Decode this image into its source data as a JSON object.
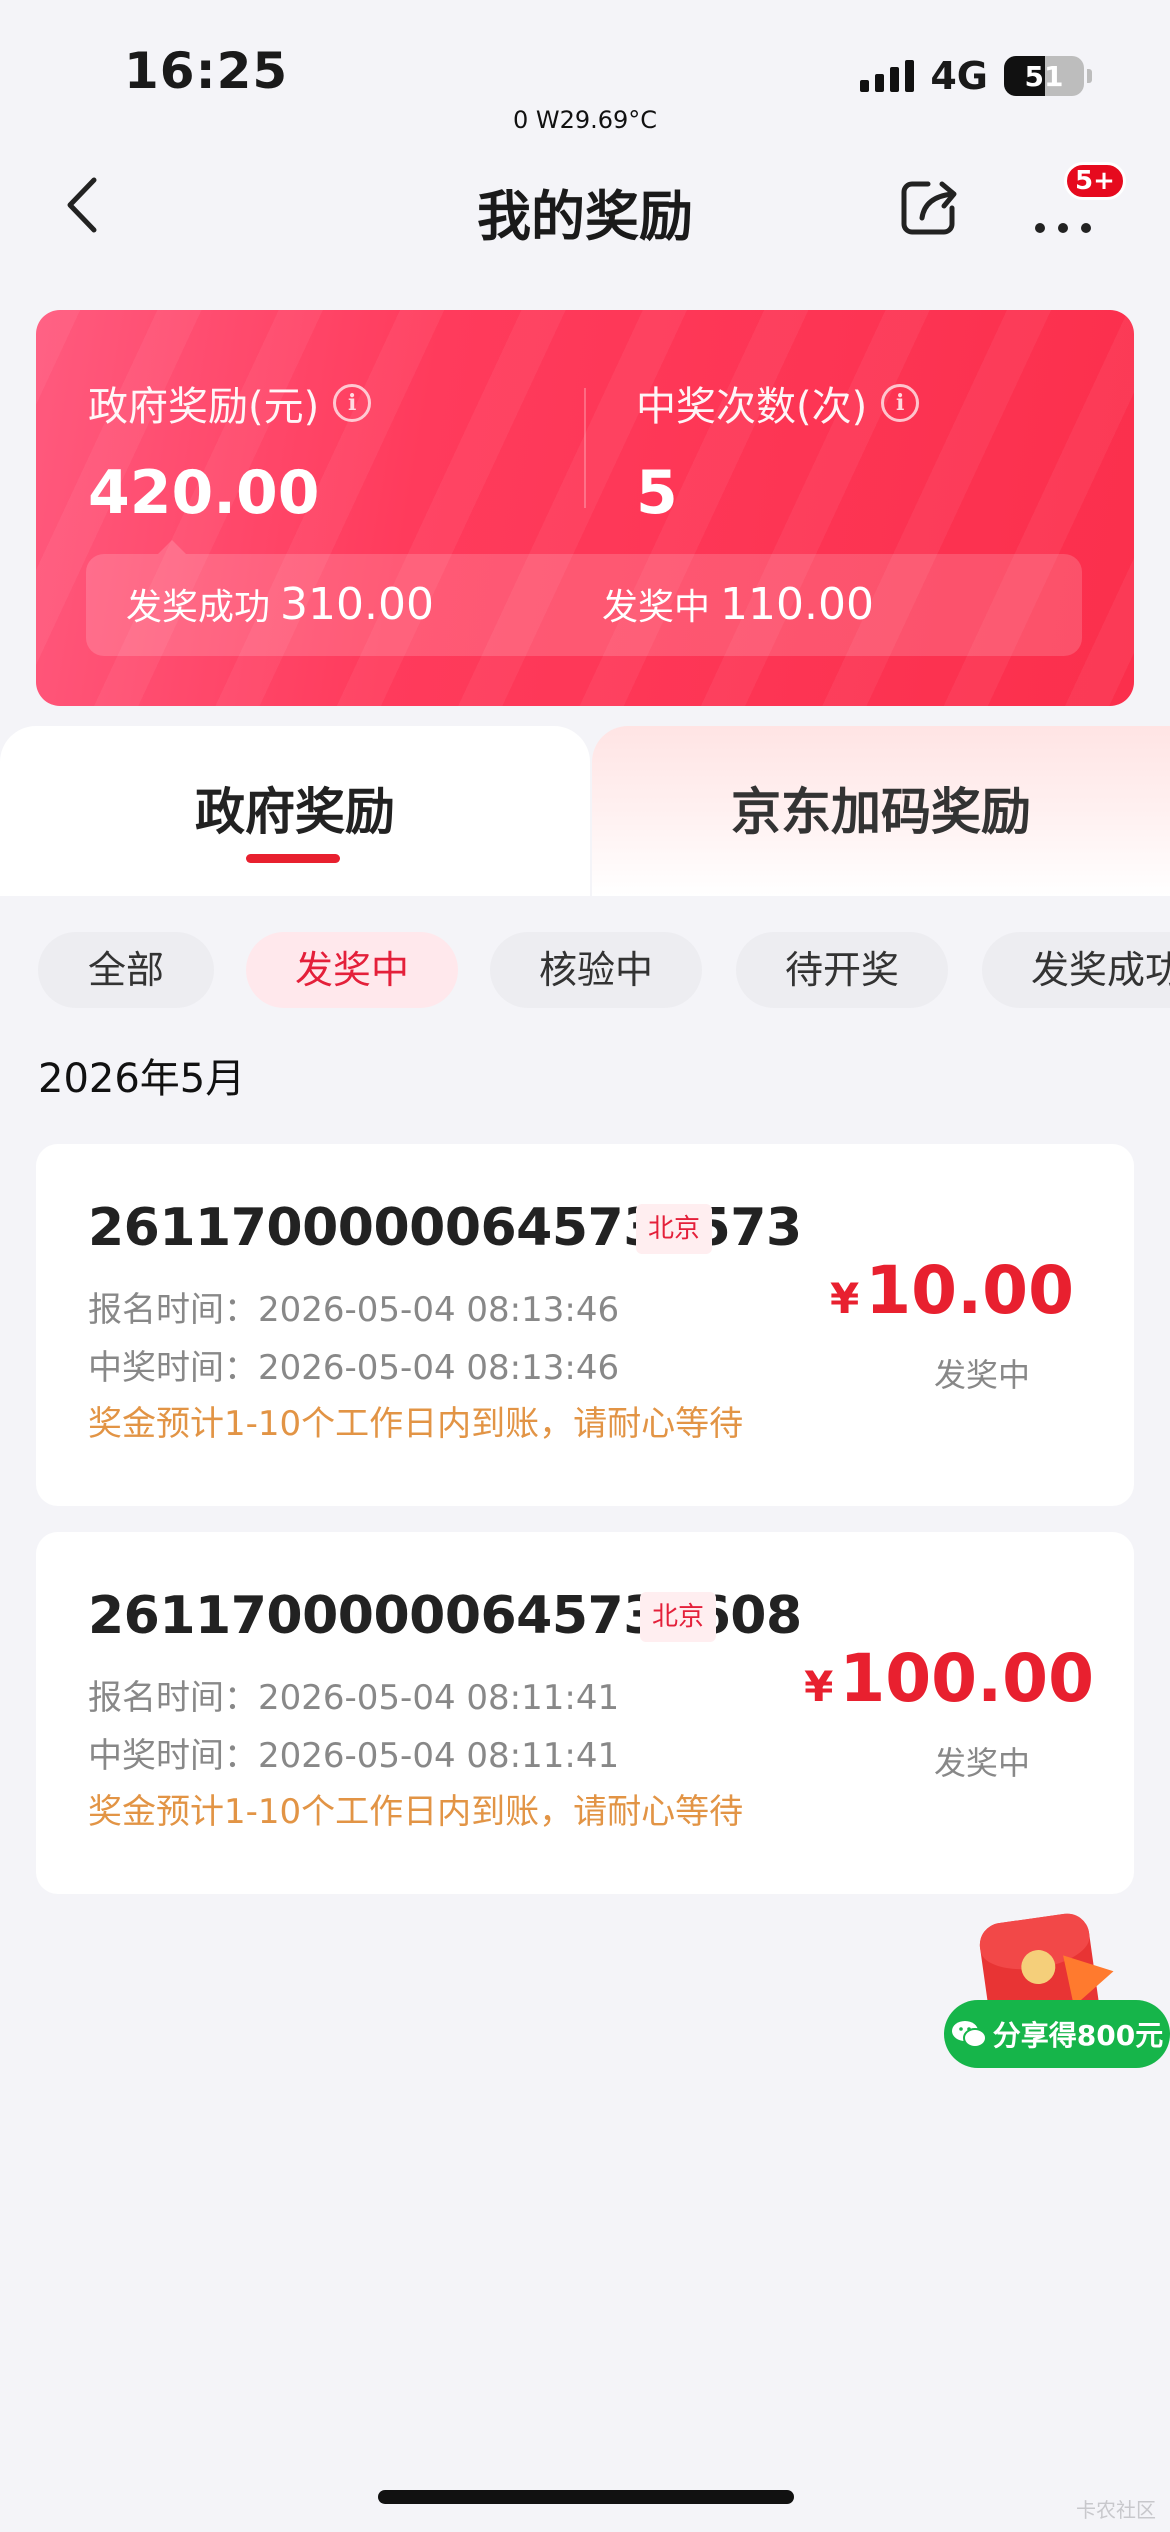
{
  "status_bar": {
    "time": "16:25",
    "subtitle": "0 W29.69°C",
    "network": "4G",
    "battery": "51",
    "battery_level": 0.51
  },
  "nav": {
    "title": "我的奖励",
    "badge": "5+"
  },
  "summary": {
    "reward_label": "政府奖励(元)",
    "reward_value": "420.00",
    "count_label": "中奖次数(次)",
    "count_value": "5",
    "success_label": "发奖成功",
    "success_value": "310.00",
    "pending_label": "发奖中",
    "pending_value": "110.00"
  },
  "tabs": [
    {
      "label": "政府奖励",
      "active": true
    },
    {
      "label": "京东加码奖励",
      "active": false
    }
  ],
  "filters": [
    {
      "label": "全部",
      "active": false
    },
    {
      "label": "发奖中",
      "active": true
    },
    {
      "label": "核验中",
      "active": false
    },
    {
      "label": "待开奖",
      "active": false
    },
    {
      "label": "发奖成功",
      "active": false
    }
  ],
  "month": "2026年5月",
  "records": [
    {
      "id": "26117000000645737573",
      "region": "北京",
      "signup_label": "报名时间：",
      "signup_time": "2026-05-04 08:13:46",
      "win_label": "中奖时间：",
      "win_time": "2026-05-04 08:13:46",
      "note": "奖金预计1-10个工作日内到账，请耐心等待",
      "currency": "¥",
      "amount": "10.00",
      "status": "发奖中"
    },
    {
      "id": "26117000000645733608",
      "region": "北京",
      "signup_label": "报名时间：",
      "signup_time": "2026-05-04 08:11:41",
      "win_label": "中奖时间：",
      "win_time": "2026-05-04 08:11:41",
      "note": "奖金预计1-10个工作日内到账，请耐心等待",
      "currency": "¥",
      "amount": "100.00",
      "status": "发奖中"
    }
  ],
  "share_float": {
    "label": "分享得800元"
  },
  "watermark": "卡农社区"
}
